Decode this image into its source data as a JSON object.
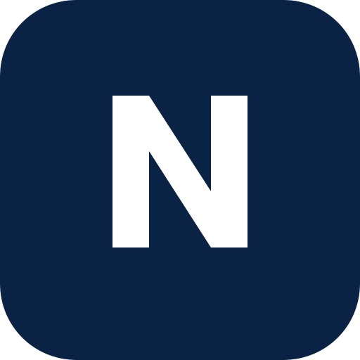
{
  "app_icon": {
    "letter": "N",
    "background_color": "#0a2345",
    "letter_color": "#ffffff"
  }
}
